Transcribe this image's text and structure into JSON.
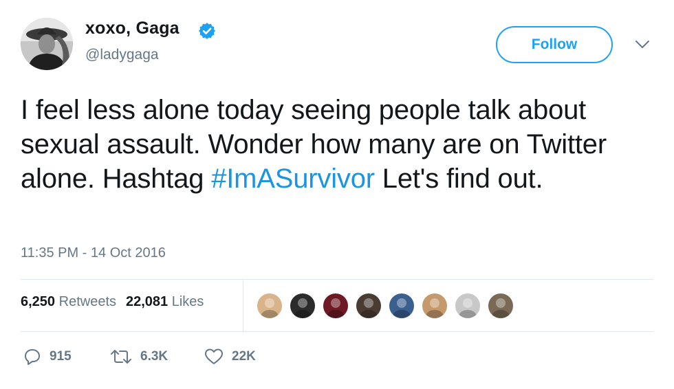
{
  "author": {
    "display_name": "xoxo, Gaga",
    "handle": "@ladygaga",
    "verified": true,
    "avatar_icon": "user-avatar"
  },
  "follow_label": "Follow",
  "tweet": {
    "text_before": "I feel less alone today seeing people talk about sexual assault. Wonder how many are on Twitter alone. Hashtag ",
    "hashtag": "#ImASurvivor",
    "text_after": " Let's find out.",
    "timestamp": "11:35 PM - 14 Oct 2016"
  },
  "stats": {
    "retweets_count": "6,250",
    "retweets_label": "Retweets",
    "likes_count": "22,081",
    "likes_label": "Likes"
  },
  "liker_avatars": [
    {
      "icon": "liker-avatar",
      "color": "#d9b48a"
    },
    {
      "icon": "liker-avatar",
      "color": "#2b2b2b"
    },
    {
      "icon": "liker-avatar",
      "color": "#6d1a24"
    },
    {
      "icon": "liker-avatar",
      "color": "#4a3b33"
    },
    {
      "icon": "liker-avatar",
      "color": "#3b5f8f"
    },
    {
      "icon": "liker-avatar",
      "color": "#c49a6c"
    },
    {
      "icon": "liker-avatar",
      "color": "#c8c8c8"
    },
    {
      "icon": "liker-avatar",
      "color": "#7a6a55"
    }
  ],
  "actions": {
    "reply_count": "915",
    "retweet_count": "6.3K",
    "like_count": "22K"
  },
  "colors": {
    "accent": "#1da1f2",
    "hashtag": "#1b95e0",
    "secondary_text": "#657786",
    "divider": "#e1e8ed"
  }
}
